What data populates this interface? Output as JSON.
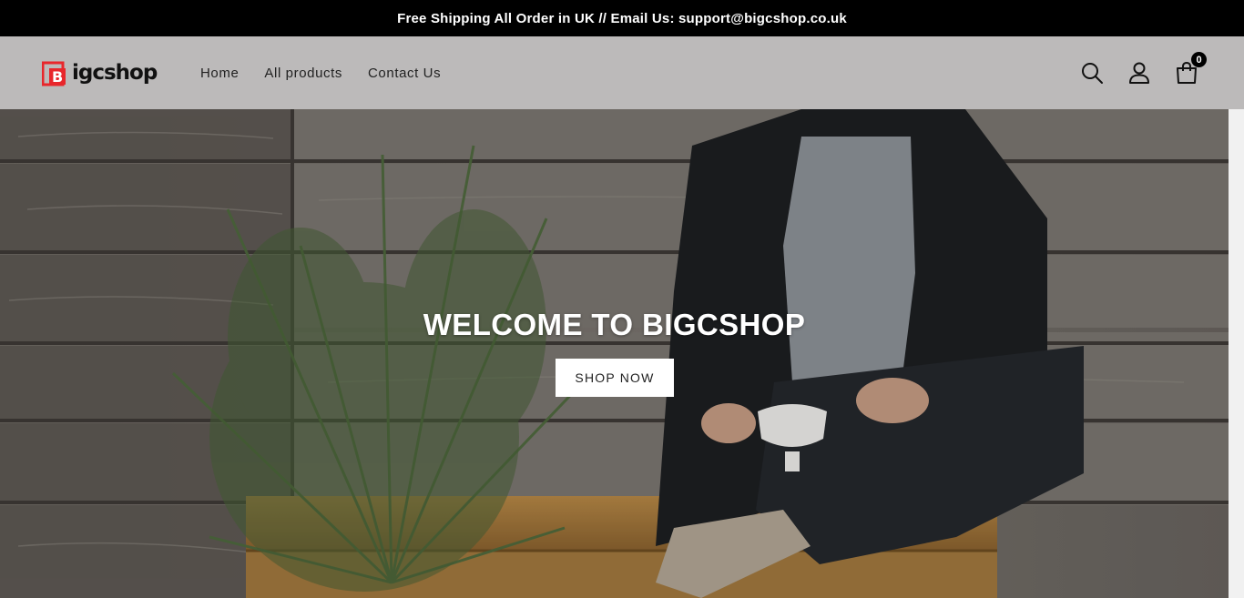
{
  "announcement": {
    "text": "Free Shipping All Order in UK // Email Us: support@bigcshop.co.uk"
  },
  "brand": {
    "logo_mark_letter": "B",
    "name": "igcshop",
    "accent_color": "#e8262b"
  },
  "nav": {
    "items": [
      {
        "label": "Home"
      },
      {
        "label": "All products"
      },
      {
        "label": "Contact Us"
      }
    ]
  },
  "header_icons": {
    "search": "search-icon",
    "account": "user-icon",
    "cart": "shopping-bag-icon",
    "cart_count": "0"
  },
  "hero": {
    "title": "WELCOME TO BIGCSHOP",
    "button_label": "SHOP NOW"
  },
  "colors": {
    "announcement_bg": "#000000",
    "header_bg": "#bcbaba",
    "button_bg": "#ffffff"
  }
}
